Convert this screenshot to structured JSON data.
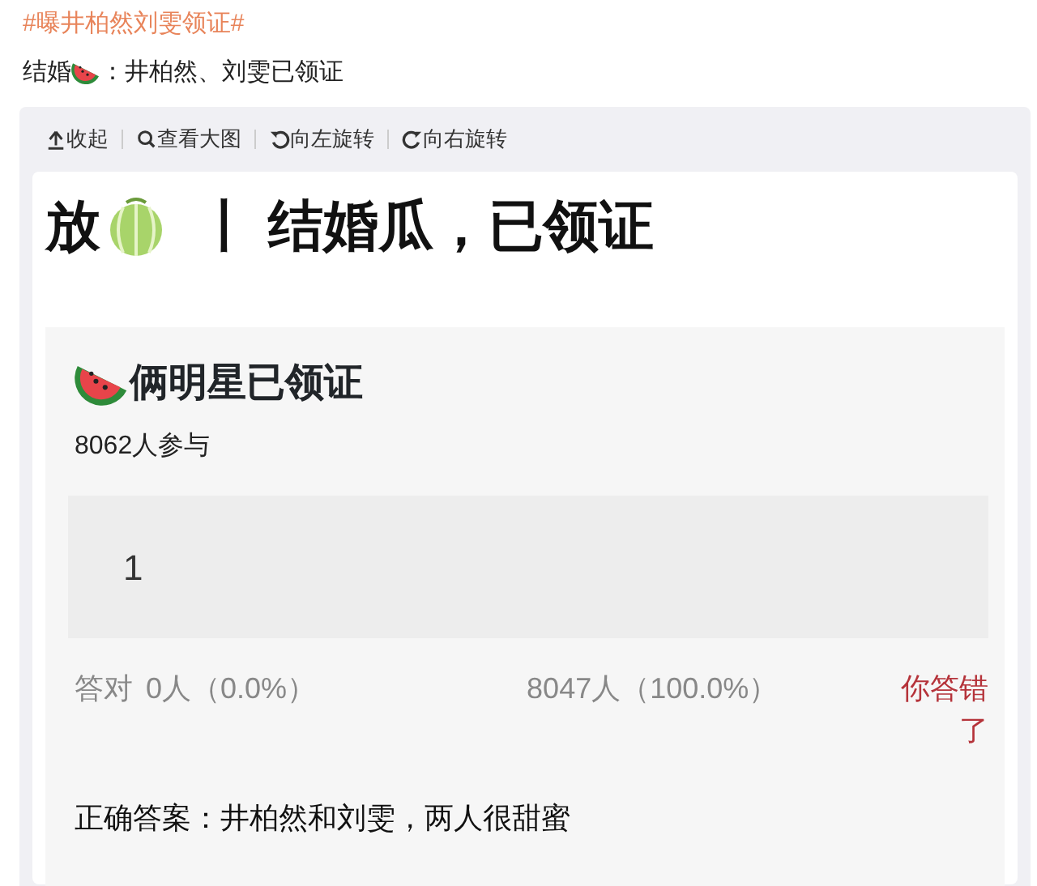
{
  "hashtag": "#曝井柏然刘雯领证#",
  "post": {
    "before_icon": "结婚",
    "after_icon": "：井柏然、刘雯已领证"
  },
  "toolbar": [
    {
      "kind": "collapse",
      "label": "收起"
    },
    {
      "kind": "zoom",
      "label": "查看大图"
    },
    {
      "kind": "rotate_left",
      "label": "向左旋转"
    },
    {
      "kind": "rotate_right",
      "label": "向右旋转"
    }
  ],
  "headline": {
    "before_icon": "放",
    "after_icon": "丨 结婚瓜，已领证"
  },
  "quiz": {
    "title": "俩明星已领证",
    "participants": "8062人参与",
    "option": "1",
    "correct_label": "答对",
    "correct_count": "0人（0.0%）",
    "option_count": "8047人（100.0%）",
    "result": "你答错了",
    "answer": "正确答案：井柏然和刘雯，两人很甜蜜"
  }
}
